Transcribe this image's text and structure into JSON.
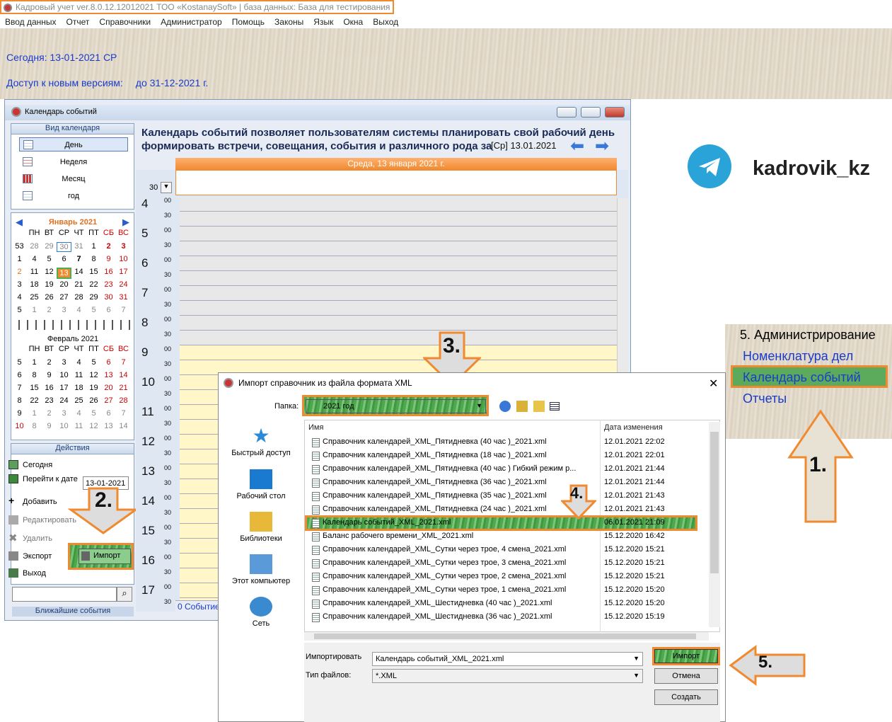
{
  "window_title": "Кадровый учет ver.8.0.12.12012021 ТОО «KostanaySoft» | база данных: База для тестирования",
  "menu": [
    "Ввод данных",
    "Отчет",
    "Справочники",
    "Администратор",
    "Помощь",
    "Законы",
    "Язык",
    "Окна",
    "Выход"
  ],
  "today_text": "Сегодня: 13-01-2021 СР",
  "access_label": "Доступ к новым версиям:",
  "access_value": "до 31-12-2021 г.",
  "telegram_name": "kadrovik_kz",
  "right_panel": {
    "heading": "5. Администрирование",
    "links": [
      "Номенклатура дел",
      "Календарь событий",
      "Отчеты"
    ]
  },
  "calwin": {
    "title": "Календарь событий",
    "view_header": "Вид календаря",
    "views": [
      "День",
      "Неделя",
      "Месяц",
      "год"
    ],
    "description": "Календарь событий позволяет пользователям системы планировать свой рабочий день формировать встречи, совещания, события и различного рода за",
    "date_overlay": "[Ср] 13.01.2021",
    "day_bar": "Среда, 13 января 2021 г.",
    "zoom": "30",
    "hours": [
      "4",
      "5",
      "6",
      "7",
      "8",
      "9",
      "10",
      "11",
      "12",
      "13",
      "14",
      "15",
      "16",
      "17"
    ],
    "min00": "00",
    "min30": "30",
    "jan_title": "Январь 2021",
    "feb_title": "Февраль 2021",
    "weekdays": [
      "ПН",
      "ВТ",
      "СР",
      "ЧТ",
      "ПТ",
      "СБ",
      "ВС"
    ],
    "actions_header": "Действия",
    "actions": [
      "Сегодня",
      "Перейти к дате",
      "Добавить",
      "Редактировать",
      "Удалить",
      "Экспорт",
      "Импорт",
      "Выход"
    ],
    "goto_date": "13-01-2021",
    "events_status": "0 Событие",
    "nearest": "Ближайшие события"
  },
  "dialog": {
    "title": "Импорт справочник из файла формата XML",
    "folder_label": "Папка:",
    "folder_value": "2021 год",
    "places": [
      "Быстрый доступ",
      "Рабочий стол",
      "Библиотеки",
      "Этот компьютер",
      "Сеть"
    ],
    "col_name": "Имя",
    "col_date": "Дата изменения",
    "files": [
      {
        "name": "Справочник календарей_XML_Пятидневка (40 час )_2021.xml",
        "date": "12.01.2021 22:02"
      },
      {
        "name": "Справочник календарей_XML_Пятидневка (18 час )_2021.xml",
        "date": "12.01.2021 22:01"
      },
      {
        "name": "Справочник календарей_XML_Пятидневка (40 час ) Гибкий режим р...",
        "date": "12.01.2021 21:44"
      },
      {
        "name": "Справочник календарей_XML_Пятидневка (36 час )_2021.xml",
        "date": "12.01.2021 21:44"
      },
      {
        "name": "Справочник календарей_XML_Пятидневка (35 час )_2021.xml",
        "date": "12.01.2021 21:43"
      },
      {
        "name": "Справочник календарей_XML_Пятидневка (24 час )_2021.xml",
        "date": "12.01.2021 21:43"
      },
      {
        "name": "Календарь событий_XML_2021.xml",
        "date": "06.01.2021 21:09"
      },
      {
        "name": "Баланс рабочего времени_XML_2021.xml",
        "date": "15.12.2020 16:42"
      },
      {
        "name": "Справочник календарей_XML_Сутки через трое, 4 смена_2021.xml",
        "date": "15.12.2020 15:21"
      },
      {
        "name": "Справочник календарей_XML_Сутки через трое, 3 смена_2021.xml",
        "date": "15.12.2020 15:21"
      },
      {
        "name": "Справочник календарей_XML_Сутки через трое, 2 смена_2021.xml",
        "date": "15.12.2020 15:21"
      },
      {
        "name": "Справочник календарей_XML_Сутки через трое, 1 смена_2021.xml",
        "date": "15.12.2020 15:20"
      },
      {
        "name": "Справочник календарей_XML_Шестидневка (40 час )_2021.xml",
        "date": "15.12.2020 15:20"
      },
      {
        "name": "Справочник календарей_XML_Шестидневка (36 час )_2021.xml",
        "date": "15.12.2020 15:19"
      }
    ],
    "import_label": "Импортировать",
    "import_value": "Календарь событий_XML_2021.xml",
    "type_label": "Тип файлов:",
    "type_value": "*.XML",
    "btn_import": "Импорт",
    "btn_cancel": "Отмена",
    "btn_create": "Создать"
  },
  "steps": [
    "1.",
    "2.",
    "3.",
    "4.",
    "5."
  ]
}
